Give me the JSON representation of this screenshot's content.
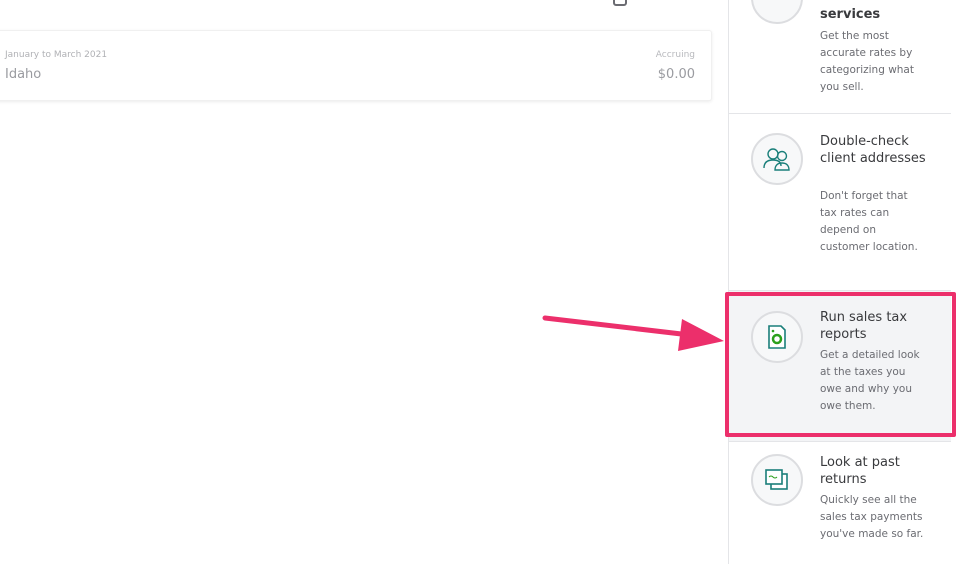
{
  "card": {
    "period": "January to March 2021",
    "state": "Idaho",
    "status_label": "Accruing",
    "amount": "$0.00"
  },
  "tips": [
    {
      "title": "services",
      "description": "Get the most accurate rates by categorizing what you sell.",
      "icon": "product-icon"
    },
    {
      "title": "Double-check client addresses",
      "description": "Don't forget that tax rates can depend on customer location.",
      "icon": "customers-icon"
    },
    {
      "title": "Run sales tax reports",
      "description": "Get a detailed look at the taxes you owe and why you owe them.",
      "icon": "report-icon"
    },
    {
      "title": "Look at past returns",
      "description": "Quickly see all the sales tax payments you've made so far.",
      "icon": "returns-icon"
    }
  ],
  "colors": {
    "highlight": "#ec2f6b",
    "accent": "#2ca01c",
    "icon_teal": "#1a7f7a"
  }
}
